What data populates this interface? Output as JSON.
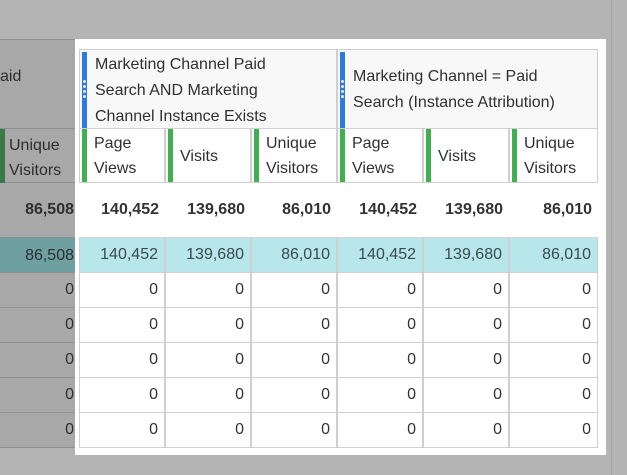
{
  "dimension": {
    "header_fragment": "aid",
    "metric_label_line1": "Unique",
    "metric_label_line2": "Visitors",
    "total": "86,508",
    "highlight_value": "86,508",
    "rows": [
      "0",
      "0",
      "0",
      "0",
      "0"
    ]
  },
  "segments": [
    {
      "title_lines": [
        "Marketing Channel Paid",
        "Search AND Marketing",
        "Channel Instance Exists"
      ],
      "columns": [
        {
          "line1": "Page",
          "line2": "Views",
          "total": "140,452",
          "highlight": "140,452",
          "rows": [
            "0",
            "0",
            "0",
            "0",
            "0"
          ]
        },
        {
          "line1": "Visits",
          "line2": "",
          "total": "139,680",
          "highlight": "139,680",
          "rows": [
            "0",
            "0",
            "0",
            "0",
            "0"
          ]
        },
        {
          "line1": "Unique",
          "line2": "Visitors",
          "total": "86,010",
          "highlight": "86,010",
          "rows": [
            "0",
            "0",
            "0",
            "0",
            "0"
          ]
        }
      ]
    },
    {
      "title_lines": [
        "Marketing Channel = Paid",
        "Search (Instance Attribution)"
      ],
      "columns": [
        {
          "line1": "Page",
          "line2": "Views",
          "total": "140,452",
          "highlight": "140,452",
          "rows": [
            "0",
            "0",
            "0",
            "0",
            "0"
          ]
        },
        {
          "line1": "Visits",
          "line2": "",
          "total": "139,680",
          "highlight": "139,680",
          "rows": [
            "0",
            "0",
            "0",
            "0",
            "0"
          ]
        },
        {
          "line1": "Unique",
          "line2": "Visitors",
          "total": "86,010",
          "highlight": "86,010",
          "rows": [
            "0",
            "0",
            "0",
            "0",
            "0"
          ]
        }
      ]
    }
  ],
  "colors": {
    "segment_bar": "#2c79e0",
    "metric_bar": "#3fb04f",
    "highlight_row": "#b7e7ea",
    "dim_overlay": "#a8a8a8"
  }
}
